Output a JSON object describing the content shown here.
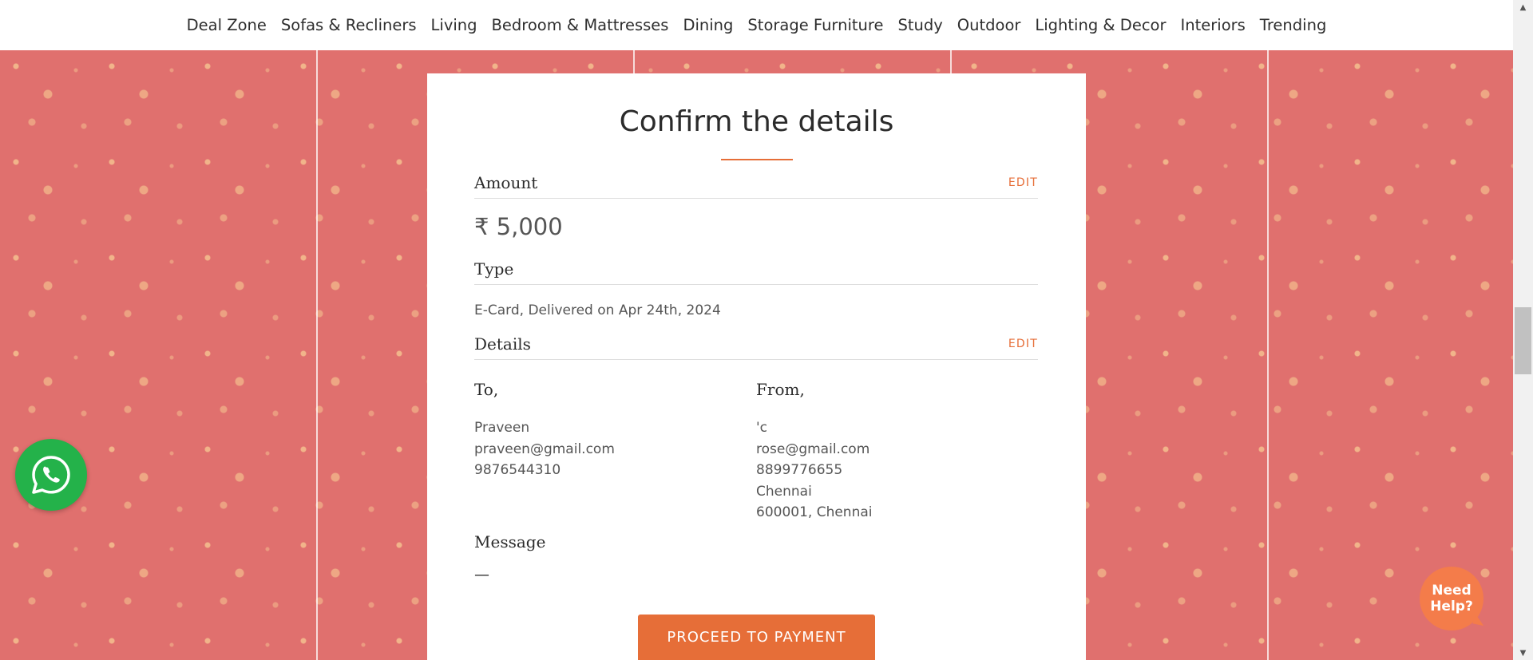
{
  "nav": {
    "items": [
      "Deal Zone",
      "Sofas & Recliners",
      "Living",
      "Bedroom & Mattresses",
      "Dining",
      "Storage Furniture",
      "Study",
      "Outdoor",
      "Lighting & Decor",
      "Interiors",
      "Trending"
    ]
  },
  "card": {
    "title": "Confirm the details",
    "amount": {
      "label": "Amount",
      "edit": "EDIT",
      "value": "₹ 5,000"
    },
    "type": {
      "label": "Type",
      "value": "E-Card, Delivered on Apr 24th, 2024"
    },
    "details": {
      "label": "Details",
      "edit": "EDIT",
      "to": {
        "label": "To,",
        "lines": [
          "Praveen",
          "praveen@gmail.com",
          "9876544310"
        ]
      },
      "from": {
        "label": "From,",
        "lines": [
          "'c",
          "rose@gmail.com",
          "8899776655",
          "Chennai",
          "600001, Chennai"
        ]
      }
    },
    "message": {
      "label": "Message",
      "value": "—"
    },
    "proceed_label": "PROCEED TO PAYMENT"
  },
  "widgets": {
    "help_line1": "Need",
    "help_line2": "Help?"
  },
  "colors": {
    "accent": "#e66e38",
    "background": "#e0706e",
    "whatsapp": "#24b24a"
  },
  "icons": [
    "whatsapp-icon",
    "scroll-up-arrow-icon",
    "scroll-down-arrow-icon"
  ]
}
